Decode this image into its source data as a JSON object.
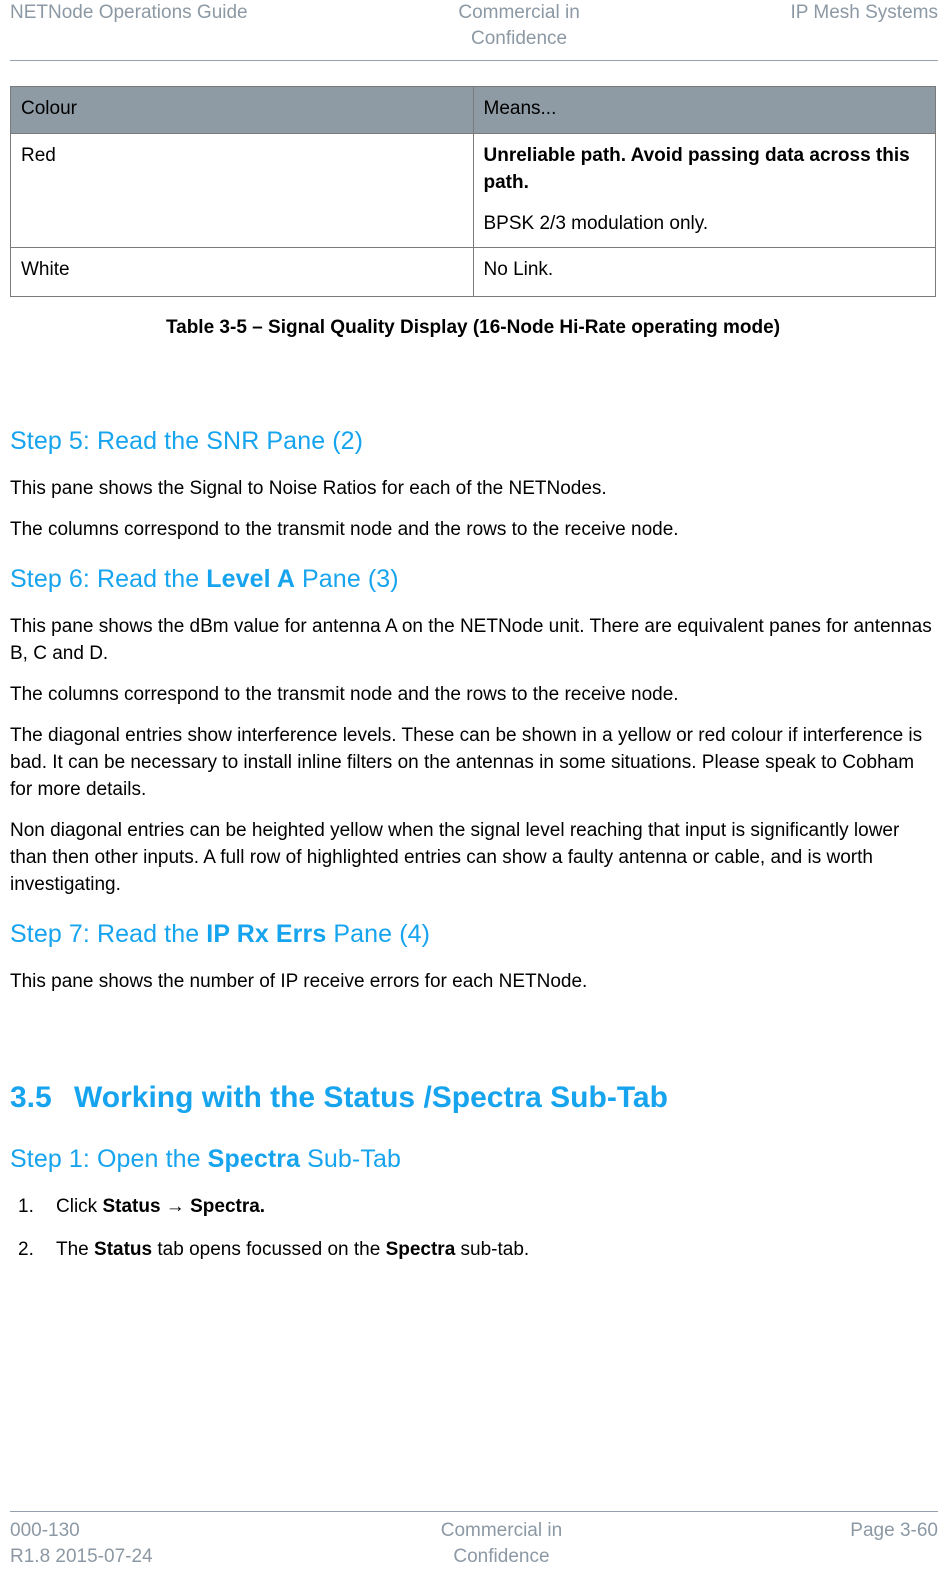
{
  "header": {
    "left": "NETNode Operations Guide",
    "center": "Commercial in\nConfidence",
    "right": "IP Mesh Systems"
  },
  "table": {
    "columns": [
      "Colour",
      "Means..."
    ],
    "rows": [
      {
        "colour": "Red",
        "means_bold": "Unreliable path. Avoid passing data across this path.",
        "means_plain": "BPSK 2/3 modulation only."
      },
      {
        "colour": "White",
        "means_bold": "",
        "means_plain": "No Link."
      }
    ],
    "caption": "Table 3-5 – Signal Quality Display (16-Node Hi-Rate operating mode)"
  },
  "sections": {
    "step5": {
      "heading_pre": "Step 5: Read the SNR Pane (2)",
      "p1": "This pane shows the Signal to Noise Ratios for each of the NETNodes.",
      "p2": "The columns correspond to the transmit node and the rows to the receive node."
    },
    "step6": {
      "heading_pre": "Step 6: Read the ",
      "heading_bold": "Level A",
      "heading_post": " Pane (3)",
      "p1": "This pane shows the dBm value for antenna A on the NETNode unit. There are equivalent panes for antennas B, C and D.",
      "p2": "The columns correspond to the transmit node and the rows to the receive node.",
      "p3": "The diagonal entries show interference levels. These can be shown in a yellow or red colour if interference is bad. It can be necessary to install inline filters on the antennas in some situations. Please speak to Cobham for more details.",
      "p4": "Non diagonal entries can be heighted yellow when the signal level reaching that input is significantly lower than then other inputs. A full row of highlighted entries can show a faulty antenna or cable, and is worth investigating."
    },
    "step7": {
      "heading_pre": "Step 7: Read the ",
      "heading_bold": "IP Rx Errs",
      "heading_post": " Pane (4)",
      "p1": "This pane shows the number of IP receive errors for each NETNode."
    },
    "section35": {
      "number": "3.5",
      "title": "Working with the Status /Spectra Sub-Tab",
      "step1_pre": "Step 1: Open the ",
      "step1_bold": "Spectra",
      "step1_post": " Sub-Tab",
      "list": [
        {
          "marker": "1.",
          "pre": "Click ",
          "bold1": "Status",
          "mid": " → ",
          "bold2": "Spectra.",
          "post": ""
        },
        {
          "marker": "2.",
          "pre": "The ",
          "bold1": "Status",
          "mid": " tab opens focussed on the ",
          "bold2": "Spectra",
          "post": " sub-tab."
        }
      ]
    }
  },
  "footer": {
    "left": "000-130\nR1.8 2015-07-24",
    "center": "Commercial in\nConfidence",
    "right": "Page 3-60"
  },
  "colors": {
    "accent_blue": "#17A4EE",
    "table_header_bg": "#8E9BA5",
    "header_footer_text": "#8C99A4",
    "rule": "#93A2AE"
  }
}
